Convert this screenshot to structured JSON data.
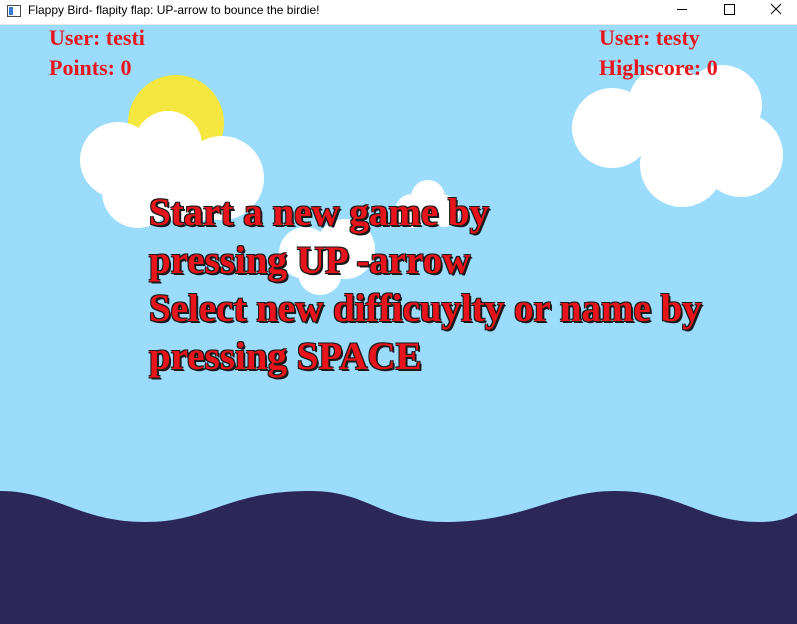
{
  "window": {
    "title": "Flappy Bird- flapity flap: UP-arrow to bounce the birdie!",
    "buttons": {
      "minimize": "minimize-icon",
      "maximize": "maximize-icon",
      "close": "close-icon"
    }
  },
  "hud": {
    "user_left": "User: testi",
    "points": "Points: 0",
    "user_right": "User: testy",
    "highscore": "Highscore: 0"
  },
  "message": {
    "line1": "Start a new game by",
    "line2": "pressing UP -arrow",
    "line3": "Select new difficuylty or name by",
    "line4": "pressing SPACE"
  },
  "colors": {
    "sky": "#9bdcfd",
    "sea": "#2b2859",
    "sun": "#f5e73f",
    "cloud": "#ffffff",
    "text": "#e8141b",
    "outline": "#1a1a1a"
  }
}
